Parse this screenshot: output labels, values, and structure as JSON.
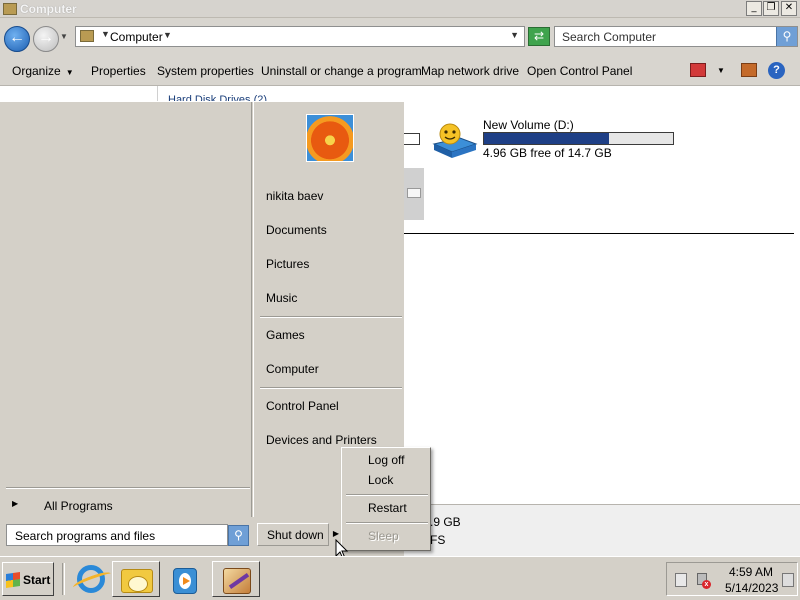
{
  "window": {
    "title": "Computer",
    "min_glyph": "_",
    "max_glyph": "❐",
    "close_glyph": "✕"
  },
  "address": {
    "crumb": "Computer",
    "search_placeholder": "Search Computer"
  },
  "toolbar": {
    "organize": "Organize",
    "properties": "Properties",
    "system_properties": "System properties",
    "uninstall": "Uninstall or change a program",
    "map_drive": "Map network drive",
    "control_panel": "Open Control Panel"
  },
  "content": {
    "group_header": "Hard Disk Drives (2)",
    "drive": {
      "name": "New Volume (D:)",
      "free_text": "4.96 GB free of 14.7 GB",
      "used_fraction": 0.66
    },
    "details": {
      "line1": ".9 GB",
      "line2": "FS"
    }
  },
  "start_menu": {
    "user_name": "nikita baev",
    "items_top": [
      "Documents",
      "Pictures",
      "Music"
    ],
    "items_mid": [
      "Games",
      "Computer"
    ],
    "items_bottom": [
      "Control Panel",
      "Devices and Printers"
    ],
    "all_programs": "All Programs",
    "search_placeholder": "Search programs and files",
    "shutdown": "Shut down"
  },
  "power_menu": {
    "log_off": "Log off",
    "lock": "Lock",
    "restart": "Restart",
    "sleep": "Sleep"
  },
  "taskbar": {
    "start_label": "Start",
    "programs": [
      "internet-explorer-icon",
      "windows-explorer-icon",
      "media-player-icon",
      "paint-icon"
    ],
    "time": "4:59 AM",
    "date": "5/14/2023"
  },
  "colors": {
    "drive_fill": "#1e3f86",
    "accent_blue": "#1d5fb2"
  }
}
